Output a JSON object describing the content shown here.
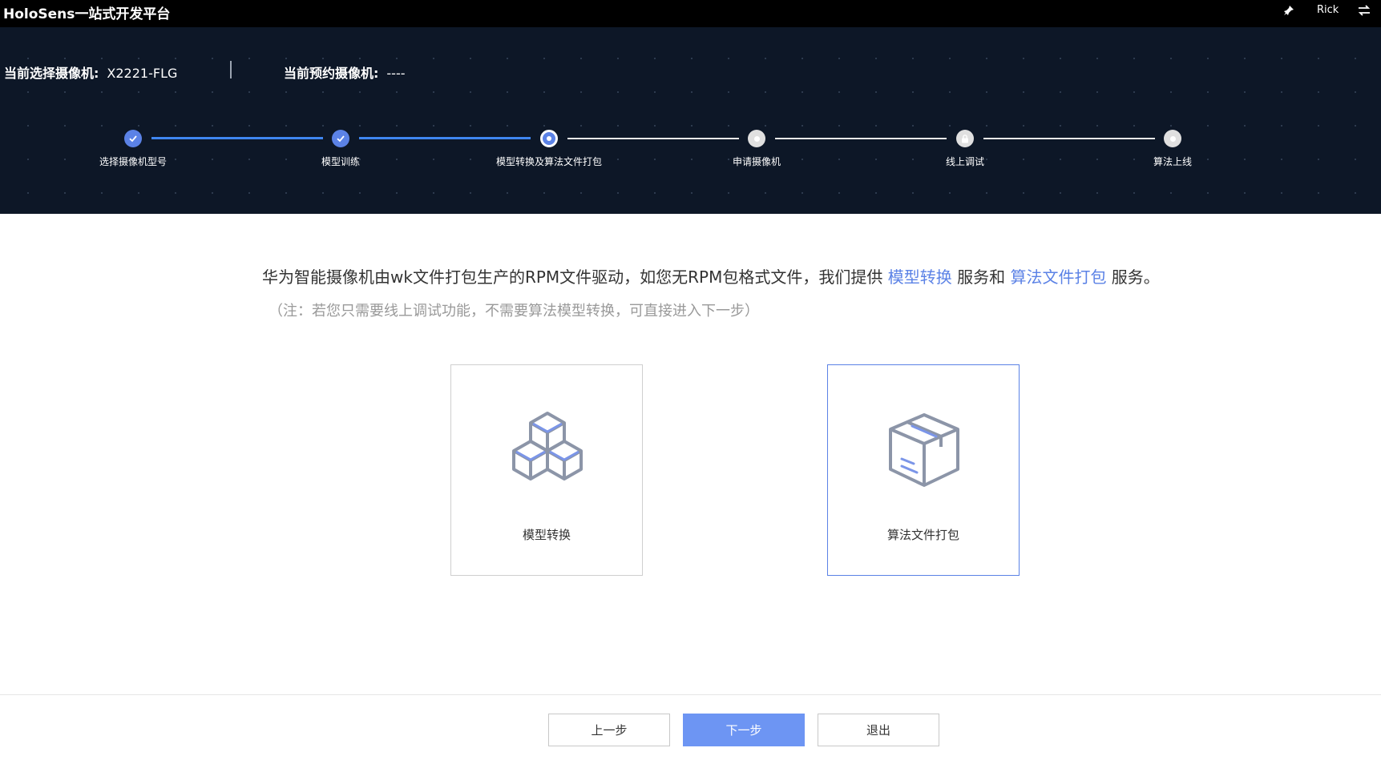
{
  "app": {
    "title": "HoloSens一站式开发平台",
    "user": "Rick"
  },
  "camera": {
    "selected_label": "当前选择摄像机:",
    "selected_value": "X2221-FLG",
    "reserved_label": "当前预约摄像机:",
    "reserved_value": "----"
  },
  "steps": [
    {
      "label": "选择摄像机型号",
      "status": "done"
    },
    {
      "label": "模型训练",
      "status": "done"
    },
    {
      "label": "模型转换及算法文件打包",
      "status": "active"
    },
    {
      "label": "申请摄像机",
      "status": "pending"
    },
    {
      "label": "线上调试",
      "status": "locked"
    },
    {
      "label": "算法上线",
      "status": "pending"
    }
  ],
  "intro": {
    "part1": "华为智能摄像机由wk文件打包生产的RPM文件驱动，如您无RPM包格式文件，我们提供 ",
    "link1": "模型转换",
    "part2": " 服务和 ",
    "link2": "算法文件打包",
    "part3": " 服务。",
    "note": "（注：若您只需要线上调试功能，不需要算法模型转换，可直接进入下一步）"
  },
  "cards": [
    {
      "label": "模型转换",
      "icon": "cubes-icon",
      "selected": false
    },
    {
      "label": "算法文件打包",
      "icon": "package-box-icon",
      "selected": true
    }
  ],
  "buttons": {
    "prev": "上一步",
    "next": "下一步",
    "exit": "退出"
  },
  "colors": {
    "accent": "#5b82e6",
    "primary_button": "#6d95f3",
    "header_bg": "#0d1727",
    "progress_line": "#3f86f0"
  }
}
